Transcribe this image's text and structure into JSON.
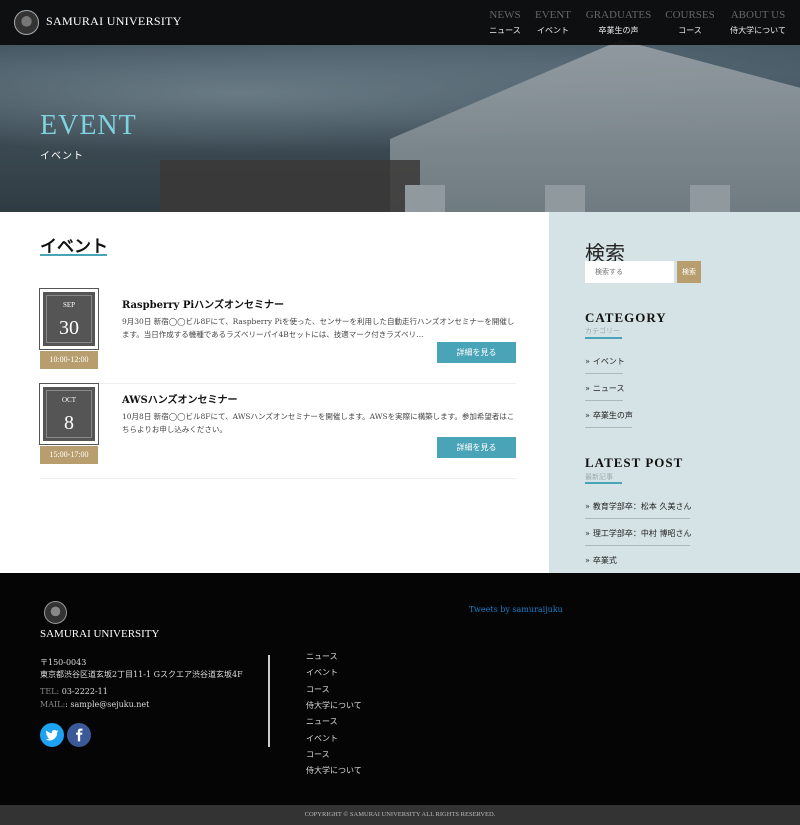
{
  "header": {
    "logo_text": "SAMURAI UNIVERSITY",
    "nav": [
      {
        "en": "NEWS",
        "ja": "ニュース"
      },
      {
        "en": "EVENT",
        "ja": "イベント"
      },
      {
        "en": "GRADUATES",
        "ja": "卒業生の声"
      },
      {
        "en": "COURSES",
        "ja": "コース"
      },
      {
        "en": "ABOUT US",
        "ja": "侍大学について"
      }
    ]
  },
  "hero": {
    "title": "EVENT",
    "subtitle": "イベント"
  },
  "main": {
    "title": "イベント",
    "events": [
      {
        "month": "SEP",
        "day": "30",
        "time": "10:00-12:00",
        "title": "Raspberry Piハンズオンセミナー",
        "desc": "9月30日 新宿◯◯ビル8Fにて、Raspberry Piを使った、センサーを利用した自動走行ハンズオンセミナーを開催します。当日作成する機種であるラズベリーパイ4Bセットには、技適マーク付きラズベリ…",
        "button": "詳細を見る"
      },
      {
        "month": "OCT",
        "day": "8",
        "time": "15:00-17:00",
        "title": "AWSハンズオンセミナー",
        "desc": "10月8日 新宿◯◯ビル8Fにて、AWSハンズオンセミナーを開催します。AWSを実際に構築します。参加希望者はこちらよりお申し込みください。",
        "button": "詳細を見る"
      }
    ]
  },
  "sidebar": {
    "search_title": "検索",
    "search_placeholder": "検索する",
    "search_button": "検索",
    "category_title": "CATEGORY",
    "category_sub": "カテゴリー",
    "categories": [
      "イベント",
      "ニュース",
      "卒業生の声"
    ],
    "latest_title": "LATEST POST",
    "latest_sub": "最新記事",
    "latest": [
      "教育学部卒：松本 久美さん",
      "理工学部卒：中村 博昭さん",
      "卒業式"
    ]
  },
  "footer": {
    "logo_text": "SAMURAI UNIVERSITY",
    "zip": "〒150-0043",
    "address": "東京都渋谷区道玄坂2丁目11-1 Gスクエア渋谷道玄坂4F",
    "tel_label": "TEL:",
    "tel": "03-2222-11",
    "mail_label": "MAIL:",
    "mail": ": sample@sejuku.net",
    "links": [
      "ニュース",
      "イベント",
      "コース",
      "侍大学について",
      "ニュース",
      "イベント",
      "コース",
      "侍大学について"
    ],
    "tweets": "Tweets by samuraijuku",
    "twitter_icon": "twitter-icon",
    "facebook_icon": "facebook-icon",
    "copyright": "COPYRIGHT © SAMURAI UNIVERSITY ALL RIGHTS RESERVED."
  },
  "colors": {
    "accent": "#4aa4b7",
    "gold": "#b89d6e",
    "sidebar_bg": "#d6e3e6"
  }
}
